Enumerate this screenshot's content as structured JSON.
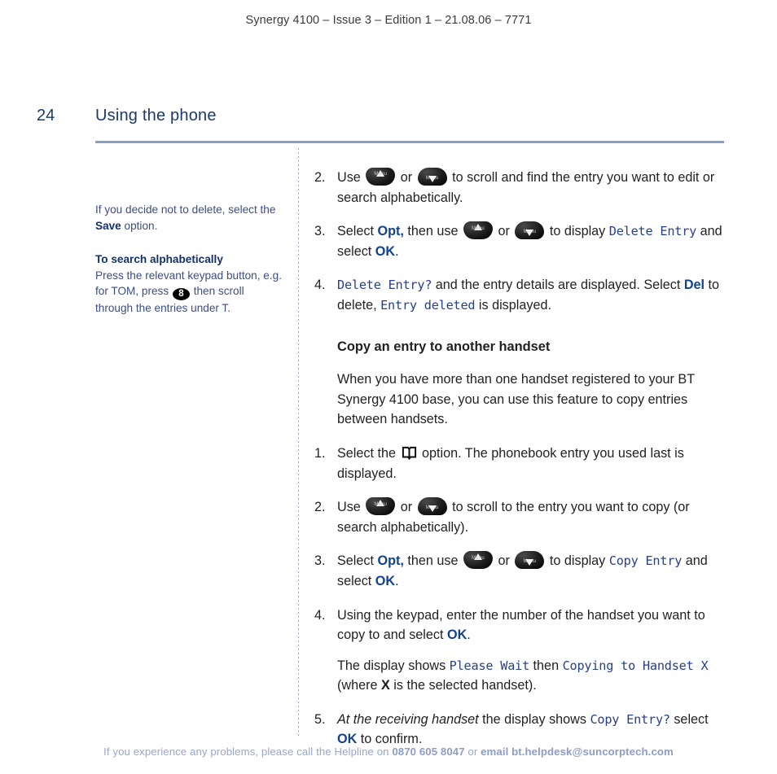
{
  "header": {
    "running_head": "Synergy 4100 – Issue 3 – Edition 1 – 21.08.06 – 7771"
  },
  "page": {
    "number": "24",
    "title": "Using the phone"
  },
  "sidebar": {
    "note1": {
      "text_before": "If you decide not to delete, select the ",
      "bold": "Save",
      "text_after": " option."
    },
    "note2": {
      "heading": "To search alphabetically",
      "text_before": "Press the relevant keypad button, e.g. for TOM, press ",
      "key": "8",
      "text_after": " then scroll through the entries under T."
    }
  },
  "main": {
    "steps": [
      {
        "num": "2.",
        "seg1": "Use ",
        "icon1": "scroll-up-menu-key",
        "seg2": " or ",
        "icon2": "scroll-down-menu-key",
        "seg3": " to scroll and find the entry you want to edit or search alphabetically."
      },
      {
        "num": "3.",
        "seg1": "Select ",
        "bold1": "Opt,",
        "seg2": " then use ",
        "icon1": "scroll-up-menu-key",
        "seg3": " or ",
        "icon2": "scroll-down-menu-key",
        "seg4": " to display ",
        "lcd1": "Delete Entry",
        "seg5": " and select ",
        "bold2": "OK",
        "seg6": "."
      },
      {
        "num": "4.",
        "lcd1": "Delete Entry?",
        "seg1": " and the entry details are displayed. Select ",
        "bold1": "Del",
        "seg2": " to delete, ",
        "lcd2": "Entry deleted",
        "seg3": " is displayed."
      }
    ],
    "section": {
      "heading": "Copy an entry to another handset",
      "intro": "When you have more than one handset registered to your BT Synergy 4100 base, you can use this feature to copy entries between handsets."
    },
    "copy_steps": [
      {
        "num": "1.",
        "seg1": "Select the ",
        "icon1": "phonebook-book-icon",
        "seg2": " option. The phonebook entry you used last is displayed."
      },
      {
        "num": "2.",
        "seg1": "Use ",
        "icon1": "scroll-up-menu-key",
        "seg2": " or ",
        "icon2": "scroll-down-menu-key",
        "seg3": " to scroll to the entry you want to copy (or search alphabetically)."
      },
      {
        "num": "3.",
        "seg1": "Select ",
        "bold1": "Opt,",
        "seg2": " then use ",
        "icon1": "scroll-up-menu-key",
        "seg3": " or ",
        "icon2": "scroll-down-menu-key",
        "seg4": " to display ",
        "lcd1": "Copy Entry",
        "seg5": " and select ",
        "bold2": "OK",
        "seg6": "."
      },
      {
        "num": "4.",
        "seg1": "Using the keypad, enter the number of the handset you want to copy to and select ",
        "bold1": "OK",
        "seg2": ".",
        "sub": {
          "seg1": "The display shows ",
          "lcd1": "Please Wait",
          "seg2": " then ",
          "lcd2": "Copying to Handset X",
          "seg3": " (where ",
          "boldx": "X",
          "seg4": " is the selected handset)."
        }
      },
      {
        "num": "5.",
        "italic1": "At the receiving handset",
        "seg1": " the display shows ",
        "lcd1": "Copy Entry?",
        "seg2": " select ",
        "bold1": "OK",
        "seg3": " to confirm."
      }
    ]
  },
  "footer": {
    "seg1": "If you experience any problems, please call the Helpline on ",
    "phone": "0870 605 8047",
    "seg2": " or ",
    "email": "email bt.helpdesk@suncorptech.com"
  },
  "colors": {
    "title_navy": "#1b3a6b",
    "rule_blue": "#8c9dc4",
    "sidebar_blue": "#3c4d86",
    "lcd_blue": "#27408b",
    "bold_navy": "#12418f",
    "footer_blue": "#98a5ce"
  }
}
